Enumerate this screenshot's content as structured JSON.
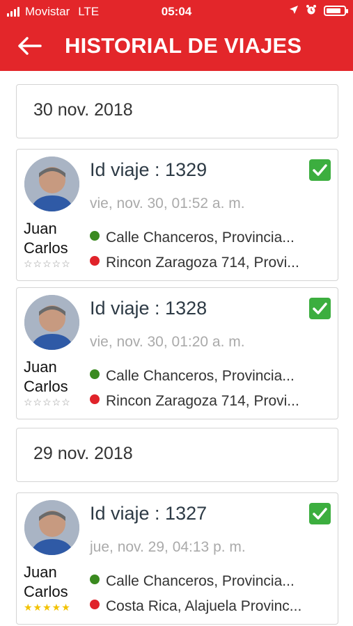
{
  "status_bar": {
    "carrier": "Movistar",
    "network": "LTE",
    "time": "05:04",
    "battery_level_percent": 85,
    "icons": [
      "signal-icon",
      "location-arrow-icon",
      "alarm-icon",
      "battery-icon"
    ]
  },
  "header": {
    "title": "HISTORIAL DE VIAJES",
    "back_icon": "arrow-left-icon",
    "background": "#e3262a"
  },
  "groups": [
    {
      "date": "30 nov. 2018"
    },
    {
      "date": "29 nov. 2018"
    }
  ],
  "trips": [
    {
      "id_label": "Id viaje : 1329",
      "time": "vie, nov. 30, 01:52 a. m.",
      "driver_first": "Juan",
      "driver_last": "Carlos",
      "stars": "☆☆☆☆☆",
      "rating": 0,
      "origin": "Calle Chanceros, Provincia...",
      "destination": "Rincon Zaragoza 714, Provi..."
    },
    {
      "id_label": "Id viaje : 1328",
      "time": "vie, nov. 30, 01:20 a. m.",
      "driver_first": "Juan",
      "driver_last": "Carlos",
      "stars": "☆☆☆☆☆",
      "rating": 0,
      "origin": "Calle Chanceros, Provincia...",
      "destination": "Rincon Zaragoza 714, Provi..."
    },
    {
      "id_label": "Id viaje : 1327",
      "time": "jue, nov. 29, 04:13 p. m.",
      "driver_first": "Juan",
      "driver_last": "Carlos",
      "stars": "★★★★★",
      "rating": 5,
      "origin": "Calle Chanceros, Provincia...",
      "destination": "Costa Rica, Alajuela Provinc..."
    }
  ],
  "colors": {
    "accent": "#e3262a",
    "origin_dot": "#3a8a1f",
    "destination_dot": "#e0232a",
    "check": "#3cae3f",
    "star": "#f2c200"
  }
}
